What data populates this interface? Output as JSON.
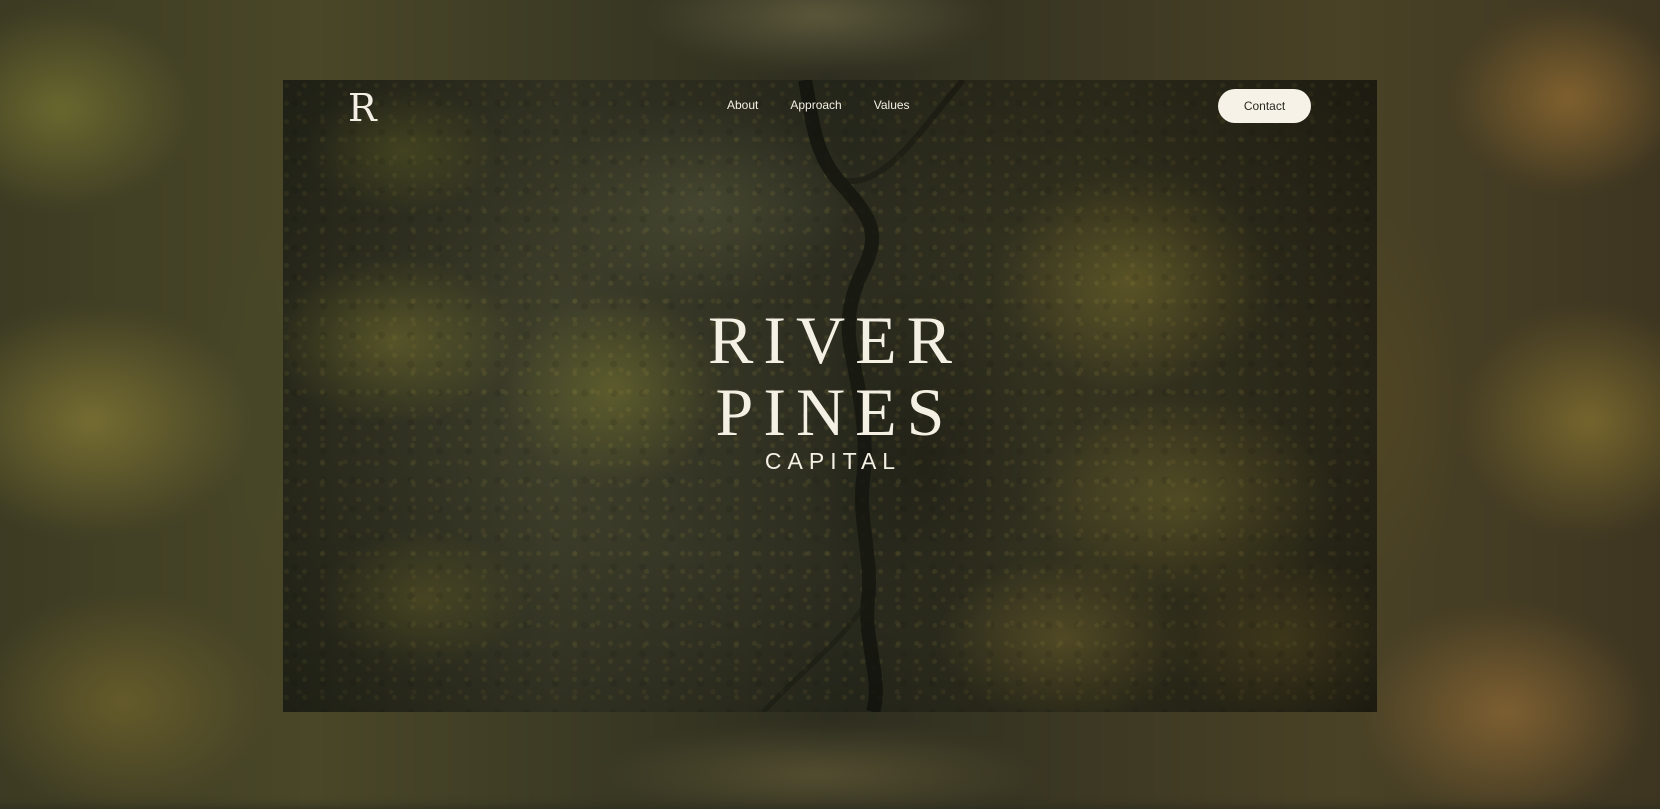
{
  "brand": {
    "logo_letter": "R",
    "name_line1": "RIVER",
    "name_line2": "PINES",
    "name_line3": "CAPITAL"
  },
  "nav": {
    "items": [
      {
        "label": "About"
      },
      {
        "label": "Approach"
      },
      {
        "label": "Values"
      }
    ],
    "contact_label": "Contact"
  },
  "colors": {
    "text_light": "#f4f0e4",
    "button_bg": "#f6f2e7",
    "button_text": "#2b2a22",
    "forest_dark": "#2f3020",
    "forest_moss": "#7d7a32"
  },
  "icons": {
    "logo": "monogram-r"
  }
}
